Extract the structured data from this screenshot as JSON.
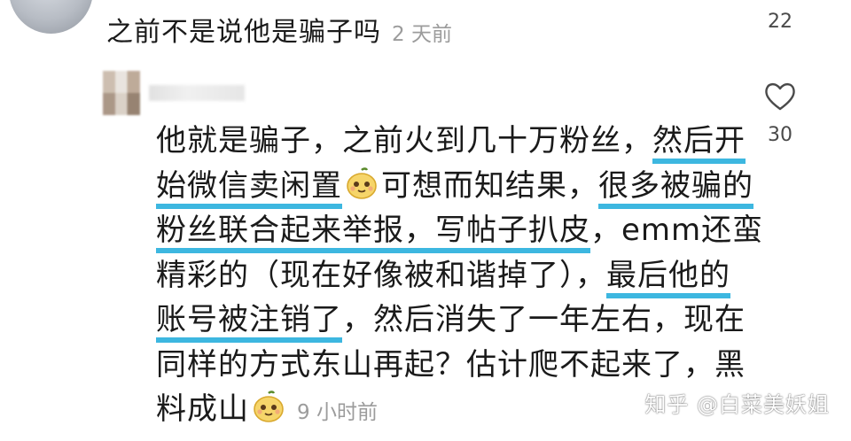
{
  "comment": {
    "text": "之前不是说他是骗子吗",
    "time": "2 天前",
    "likes": "22"
  },
  "reply": {
    "likes": "30",
    "time": "9 小时前",
    "line1_a": "他就是骗子，之前火到几十万粉丝，",
    "line1_b": "然后开",
    "line2_a": "始微信卖闲置",
    "line2_b": "可想而知结果，",
    "line2_c": "很多被骗的",
    "line3_a": "粉丝联合起来举报，写帖子扒皮",
    "line3_b": "，emm还蛮",
    "line4_a": "精彩的（现在好像被和谐掉了），",
    "line4_b": "最后他的",
    "line5_a": "账号被注销了",
    "line5_b": "，然后消失了一年左右，现在",
    "line6": "同样的方式东山再起？估计爬不起来了，黑",
    "line7": "料成山"
  },
  "watermark": "知乎 @白菜美妖姐",
  "icons": {
    "like": "heart-icon",
    "sticker": "melon-face-emoji-icon"
  },
  "colors": {
    "highlight": "#3db7e0",
    "timestamp": "#9c9c9c"
  }
}
